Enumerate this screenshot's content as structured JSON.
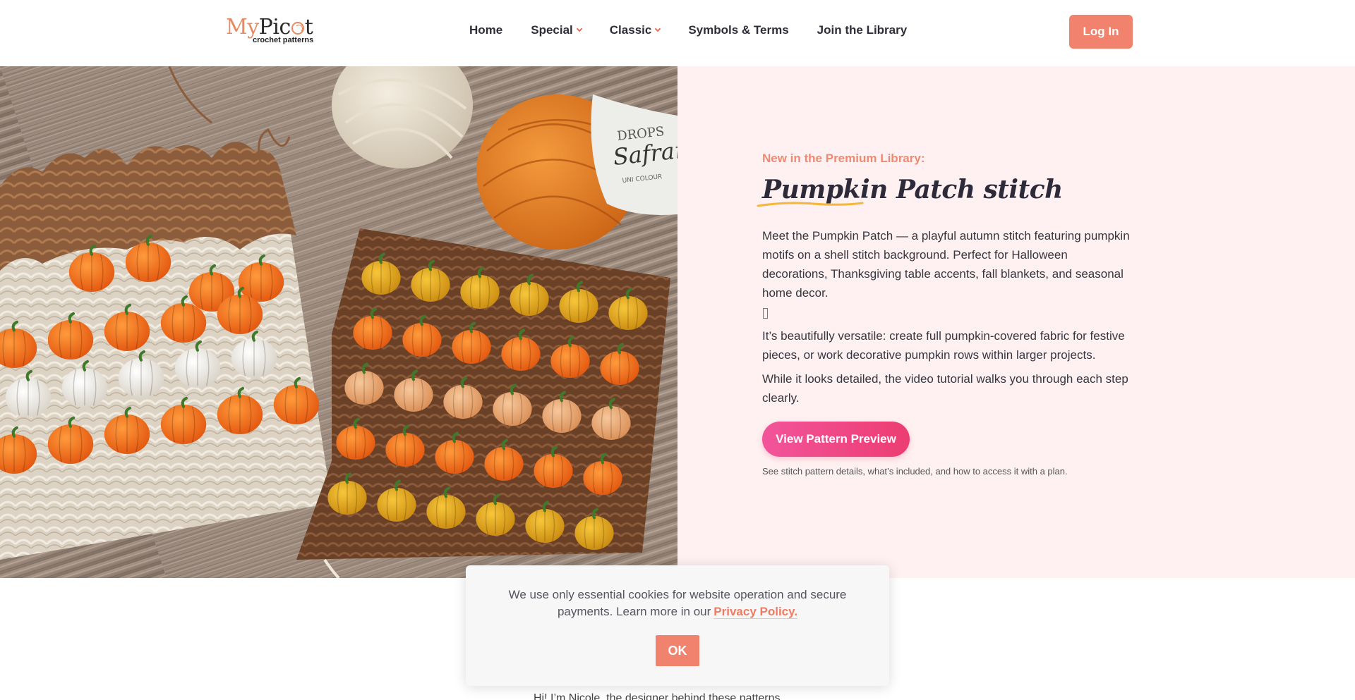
{
  "header": {
    "logo": {
      "brand_my": "My",
      "brand_pic": "Pic",
      "brand_t": "t",
      "tagline": "crochet patterns"
    },
    "nav": [
      {
        "label": "Home",
        "dropdown": false
      },
      {
        "label": "Special",
        "dropdown": true
      },
      {
        "label": "Classic",
        "dropdown": true
      },
      {
        "label": "Symbols & Terms",
        "dropdown": false
      },
      {
        "label": "Join the Library",
        "dropdown": false
      }
    ],
    "login_label": "Log In"
  },
  "hero": {
    "eyebrow": "New in the Premium Library:",
    "title": "Pumpkin Patch stitch",
    "paragraph_1": "Meet the Pumpkin Patch — a playful autumn stitch featuring pumpkin motifs on a shell stitch background. Perfect for Halloween decorations, Thanksgiving table accents, fall blankets, and seasonal home decor.",
    "paragraph_2": "It’s beautifully versatile: create full pumpkin-covered fabric for festive pieces, or work decorative pumpkin rows within larger projects.",
    "paragraph_3": "While it looks detailed, the video tutorial walks you through each step clearly.",
    "cta_label": "View Pattern Preview",
    "cta_note": "See stitch pattern details, what’s included, and how to access it with a plan.",
    "image": {
      "label_brand": "DROPS",
      "label_name": "Safran",
      "label_sub": "UNI COLOUR"
    }
  },
  "below": {
    "partial_text": "Hi! I’m Nicole, the designer behind these patterns"
  },
  "cookie_banner": {
    "text": "We use only essential cookies for website operation and secure payments. Learn more in our",
    "link_label": "Privacy Policy.",
    "ok_label": "OK"
  },
  "colors": {
    "accent": "#f0826e",
    "cta_pink": "#ec3d72",
    "hero_bg": "#fff1f1"
  }
}
